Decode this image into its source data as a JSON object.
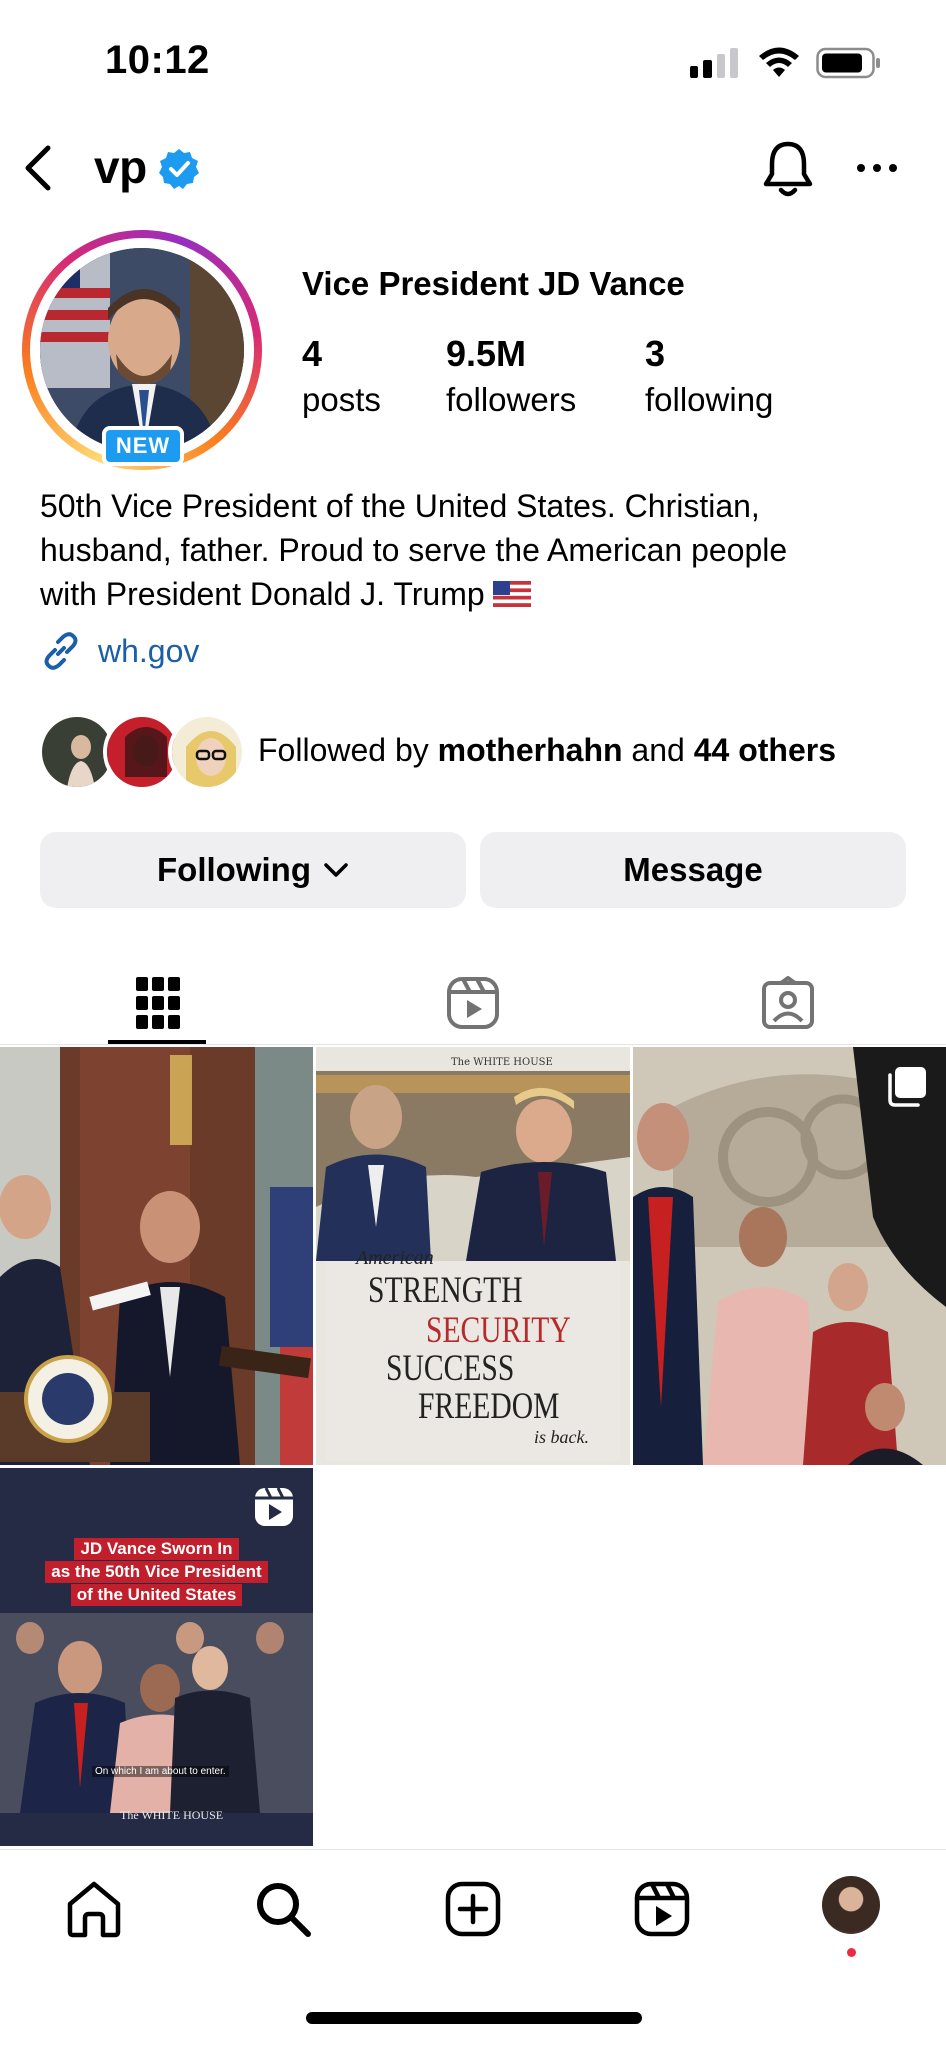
{
  "status_bar": {
    "time": "10:12"
  },
  "header": {
    "username": "vp"
  },
  "profile": {
    "avatar_badge": "NEW",
    "display_name": "Vice President JD Vance",
    "stats": [
      {
        "value": "4",
        "label": "posts"
      },
      {
        "value": "9.5M",
        "label": "followers"
      },
      {
        "value": "3",
        "label": "following"
      }
    ],
    "bio_lines": [
      "50th Vice President of the United States. Christian,",
      "husband, father. Proud to serve the American people",
      "with President Donald J. Trump"
    ],
    "link": "wh.gov",
    "followed_by": {
      "prefix": "Followed by ",
      "user": "motherhahn",
      "middle": " and ",
      "others": "44 others"
    }
  },
  "actions": {
    "following_label": "Following",
    "message_label": "Message"
  },
  "tabs": [
    "posts-grid",
    "reels",
    "tagged"
  ],
  "posts": [
    {
      "kind": "photo",
      "description": "swearing-in ceremony"
    },
    {
      "kind": "graphic",
      "header": "The WHITE HOUSE",
      "lines": [
        "American",
        "STRENGTH",
        "SECURITY",
        "SUCCESS",
        "FREEDOM",
        "is back."
      ]
    },
    {
      "kind": "carousel"
    },
    {
      "kind": "reel",
      "title_lines": [
        "JD Vance Sworn In",
        "as the 50th Vice President",
        "of the United States"
      ],
      "caption": "On which I am about to enter.",
      "footer": "The WHITE HOUSE"
    }
  ],
  "colors": {
    "verified": "#1d9bf0",
    "link": "#1a5fa8",
    "button_bg": "#efeff1",
    "notification_dot": "#ed2a3f"
  }
}
